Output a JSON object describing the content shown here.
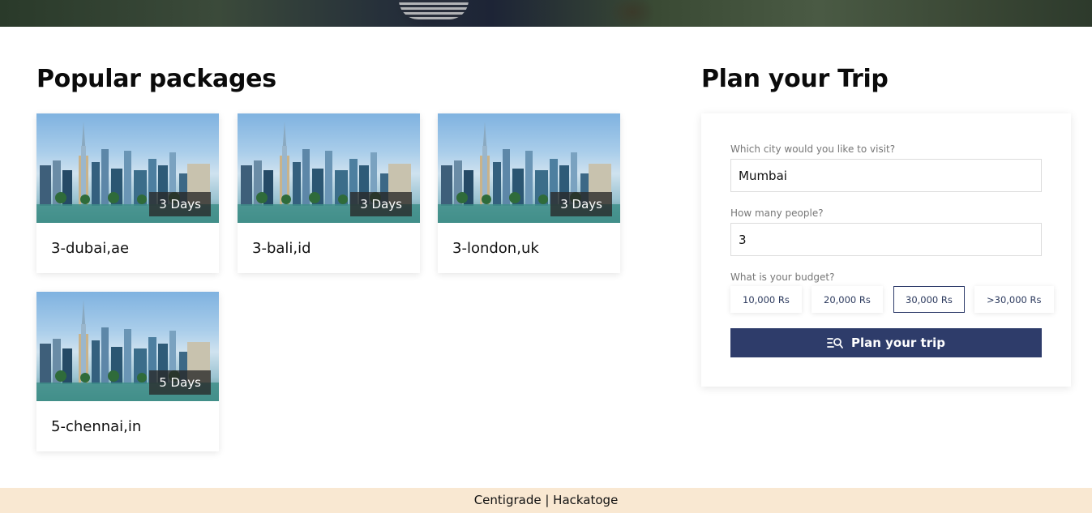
{
  "packages_section": {
    "title": "Popular packages",
    "cards": [
      {
        "name": "3-dubai,ae",
        "days": "3 Days"
      },
      {
        "name": "3-bali,id",
        "days": "3 Days"
      },
      {
        "name": "3-london,uk",
        "days": "3 Days"
      },
      {
        "name": "5-chennai,in",
        "days": "5 Days"
      }
    ]
  },
  "plan_section": {
    "title": "Plan your Trip",
    "city_label": "Which city would you like to visit?",
    "city_value": "Mumbai",
    "people_label": "How many people?",
    "people_value": "3",
    "budget_label": "What is your budget?",
    "budget_options": [
      "10,000 Rs",
      "20,000 Rs",
      "30,000 Rs",
      ">30,000 Rs"
    ],
    "selected_budget": "30,000 Rs",
    "button_label": "Plan your trip",
    "button_icon": "search-list-icon"
  },
  "footer": {
    "text": "Centigrade | Hackatoge"
  },
  "colors": {
    "primary": "#2e3c6a",
    "footer_bg": "#f9e8d2"
  }
}
